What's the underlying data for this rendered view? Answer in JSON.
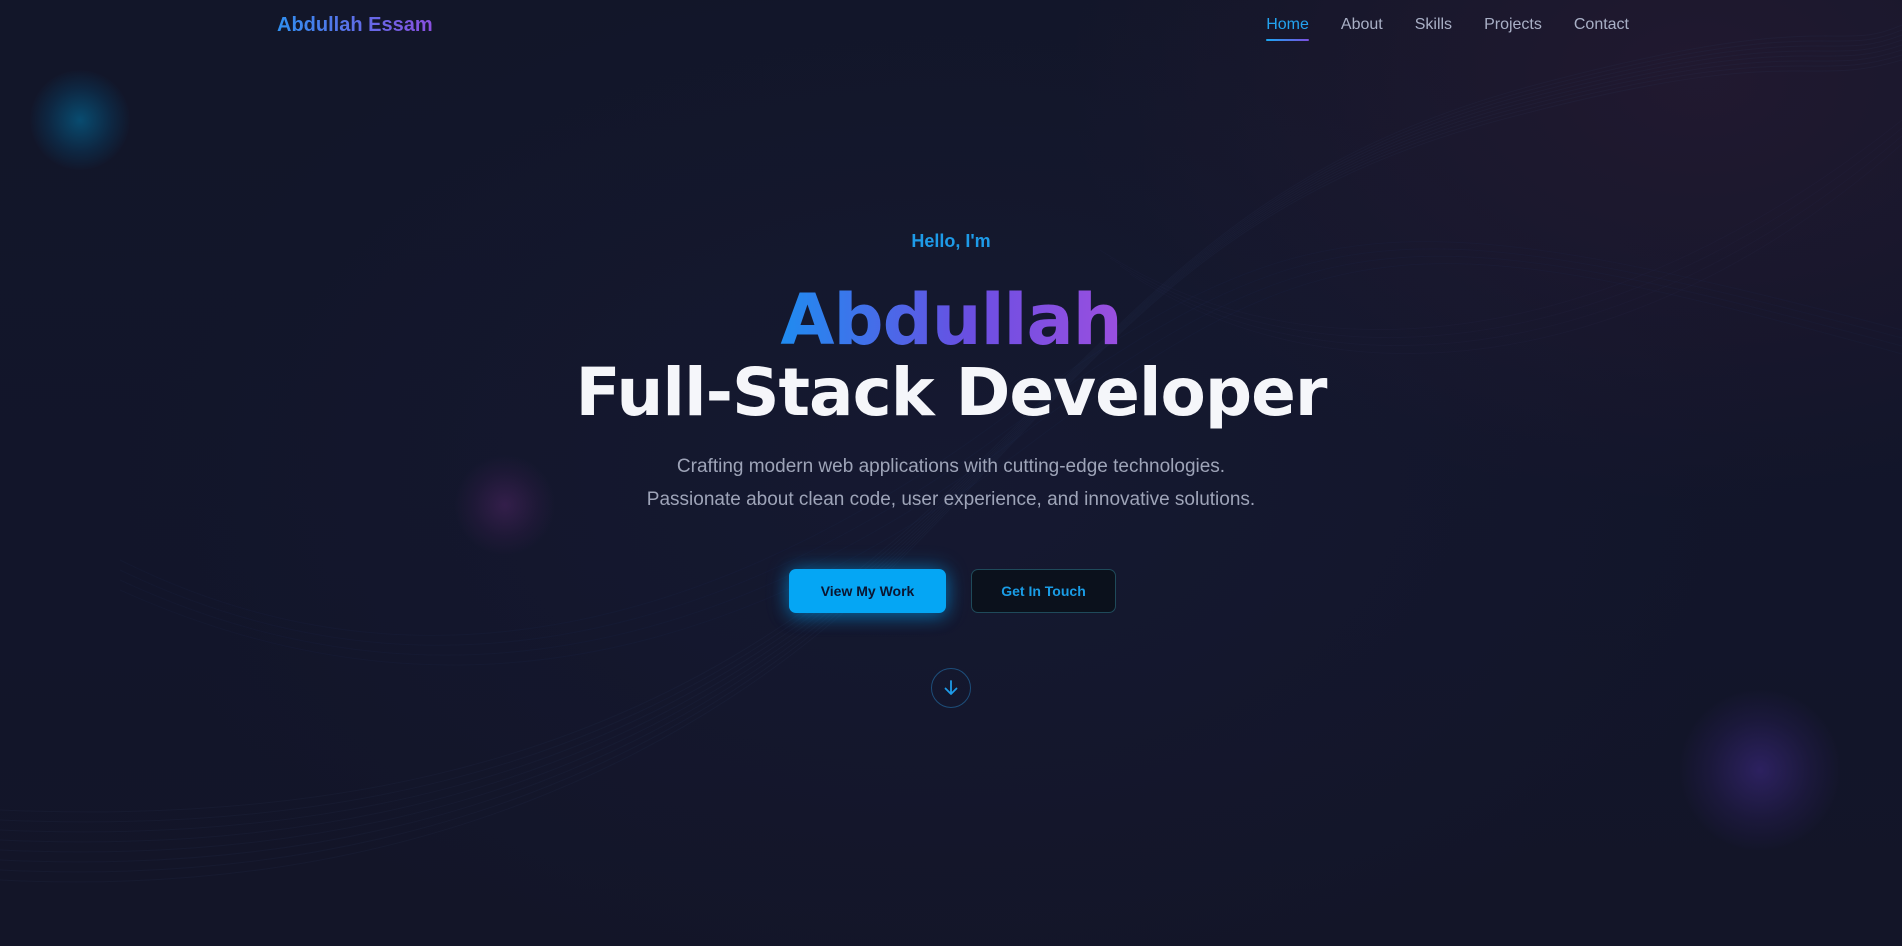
{
  "navbar": {
    "brand": "Abdullah Essam",
    "links": [
      {
        "label": "Home",
        "active": true
      },
      {
        "label": "About",
        "active": false
      },
      {
        "label": "Skills",
        "active": false
      },
      {
        "label": "Projects",
        "active": false
      },
      {
        "label": "Contact",
        "active": false
      }
    ]
  },
  "hero": {
    "greeting": "Hello, I'm",
    "name": "Abdullah",
    "role": "Full-Stack Developer",
    "tagline_line1": "Crafting modern web applications with cutting-edge technologies.",
    "tagline_line2": "Passionate about clean code, user experience, and innovative solutions.",
    "primary_button": "View My Work",
    "secondary_button": "Get In Touch",
    "scroll_icon": "arrow-down-icon"
  },
  "colors": {
    "background": "#111426",
    "accent_cyan": "#05a6f4",
    "accent_purple": "#8a4fe0",
    "heading_white": "#f5f6fa",
    "muted_text": "#9ea4b8"
  }
}
